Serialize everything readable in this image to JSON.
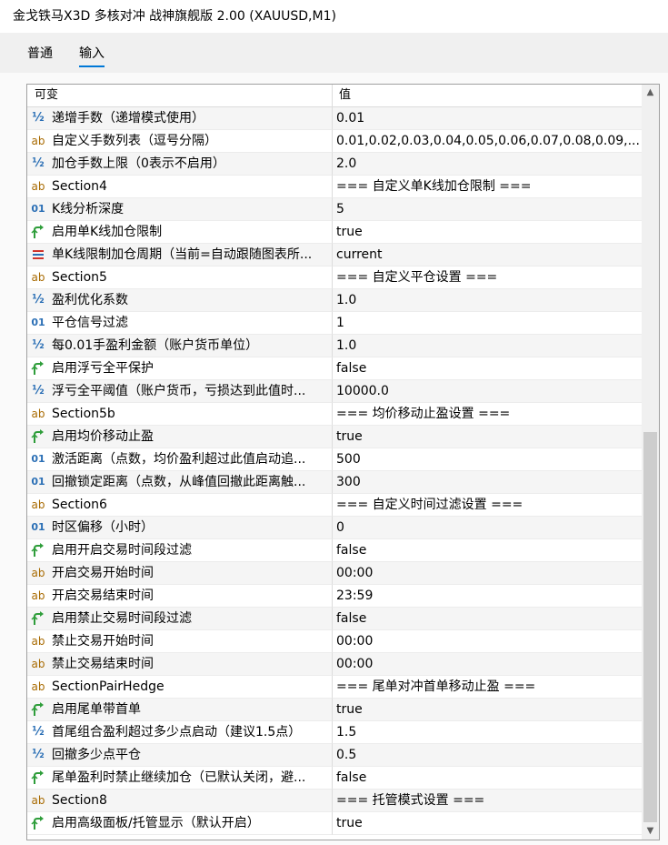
{
  "window": {
    "title": "金戈铁马X3D 多核对冲 战神旗舰版 2.00 (XAUUSD,M1)"
  },
  "tabs": [
    {
      "label": "普通"
    },
    {
      "label": "输入"
    }
  ],
  "grid": {
    "columns": {
      "name": "可变",
      "value": "值"
    },
    "rows": [
      {
        "icon": "fraction-icon",
        "name": "递增手数（递增模式使用）",
        "value": "0.01"
      },
      {
        "icon": "string-icon",
        "name": "自定义手数列表（逗号分隔）",
        "value": "0.01,0.02,0.03,0.04,0.05,0.06,0.07,0.08,0.09,..."
      },
      {
        "icon": "fraction-icon",
        "name": "加仓手数上限（0表示不启用）",
        "value": "2.0"
      },
      {
        "icon": "string-icon",
        "name": "Section4",
        "value": "=== 自定义单K线加仓限制 ==="
      },
      {
        "icon": "integer-icon",
        "name": "K线分析深度",
        "value": "5"
      },
      {
        "icon": "bool-icon",
        "name": "启用单K线加仓限制",
        "value": "true"
      },
      {
        "icon": "enum-icon",
        "name": "单K线限制加仓周期（当前=自动跟随图表所...",
        "value": "current"
      },
      {
        "icon": "string-icon",
        "name": "Section5",
        "value": "=== 自定义平仓设置 ==="
      },
      {
        "icon": "fraction-icon",
        "name": "盈利优化系数",
        "value": "1.0"
      },
      {
        "icon": "integer-icon",
        "name": "平仓信号过滤",
        "value": "1"
      },
      {
        "icon": "fraction-icon",
        "name": "每0.01手盈利金额（账户货币单位）",
        "value": "1.0"
      },
      {
        "icon": "bool-icon",
        "name": "启用浮亏全平保护",
        "value": "false"
      },
      {
        "icon": "fraction-icon",
        "name": "浮亏全平阈值（账户货币，亏损达到此值时...",
        "value": "10000.0"
      },
      {
        "icon": "string-icon",
        "name": "Section5b",
        "value": "=== 均价移动止盈设置 ==="
      },
      {
        "icon": "bool-icon",
        "name": "启用均价移动止盈",
        "value": "true"
      },
      {
        "icon": "integer-icon",
        "name": "激活距离（点数，均价盈利超过此值启动追...",
        "value": "500"
      },
      {
        "icon": "integer-icon",
        "name": "回撤锁定距离（点数，从峰值回撤此距离触...",
        "value": "300"
      },
      {
        "icon": "string-icon",
        "name": "Section6",
        "value": "=== 自定义时间过滤设置 ==="
      },
      {
        "icon": "integer-icon",
        "name": "时区偏移（小时）",
        "value": "0"
      },
      {
        "icon": "bool-icon",
        "name": "启用开启交易时间段过滤",
        "value": "false"
      },
      {
        "icon": "string-icon",
        "name": "开启交易开始时间",
        "value": "00:00"
      },
      {
        "icon": "string-icon",
        "name": "开启交易结束时间",
        "value": "23:59"
      },
      {
        "icon": "bool-icon",
        "name": "启用禁止交易时间段过滤",
        "value": "false"
      },
      {
        "icon": "string-icon",
        "name": "禁止交易开始时间",
        "value": "00:00"
      },
      {
        "icon": "string-icon",
        "name": "禁止交易结束时间",
        "value": "00:00"
      },
      {
        "icon": "string-icon",
        "name": "SectionPairHedge",
        "value": "=== 尾单对冲首单移动止盈 ==="
      },
      {
        "icon": "bool-icon",
        "name": "启用尾单带首单",
        "value": "true"
      },
      {
        "icon": "fraction-icon",
        "name": "首尾组合盈利超过多少点启动（建议1.5点）",
        "value": "1.5"
      },
      {
        "icon": "fraction-icon",
        "name": "回撤多少点平仓",
        "value": "0.5"
      },
      {
        "icon": "bool-icon",
        "name": "尾单盈利时禁止继续加仓（已默认关闭，避...",
        "value": "false"
      },
      {
        "icon": "string-icon",
        "name": "Section8",
        "value": "=== 托管模式设置 ==="
      },
      {
        "icon": "bool-icon",
        "name": "启用高级面板/托管显示（默认开启）",
        "value": "true"
      }
    ]
  },
  "icon_glyphs": {
    "fraction-icon": "½",
    "string-icon": "ab",
    "integer-icon": "01"
  },
  "colors": {
    "accent": "#0078d7",
    "bool_icon": "#2e9d3a",
    "enum_icon_blue": "#2b6fb5",
    "enum_icon_red": "#d0342c"
  }
}
